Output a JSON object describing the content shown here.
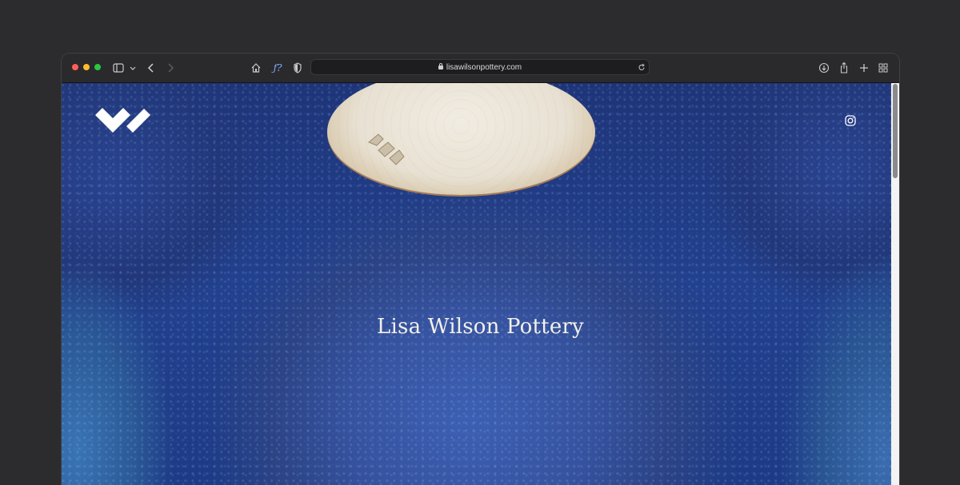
{
  "browser": {
    "url": "lisawilsonpottery.com",
    "traffic_colors": [
      "#ff5f57",
      "#febc2e",
      "#28c840"
    ],
    "left_icons": [
      "sidebar-icon",
      "chevron-down-icon",
      "back-icon",
      "forward-icon"
    ],
    "center_icons": [
      "home-icon",
      "formula-extension-icon",
      "privacy-shield-icon"
    ],
    "right_icons": [
      "download-icon",
      "share-icon",
      "new-tab-icon",
      "tab-overview-icon"
    ],
    "extension_label": "ƒ?"
  },
  "site": {
    "title": "Lisa Wilson Pottery",
    "logo": "lw-logo",
    "social_icon": "instagram-icon"
  }
}
